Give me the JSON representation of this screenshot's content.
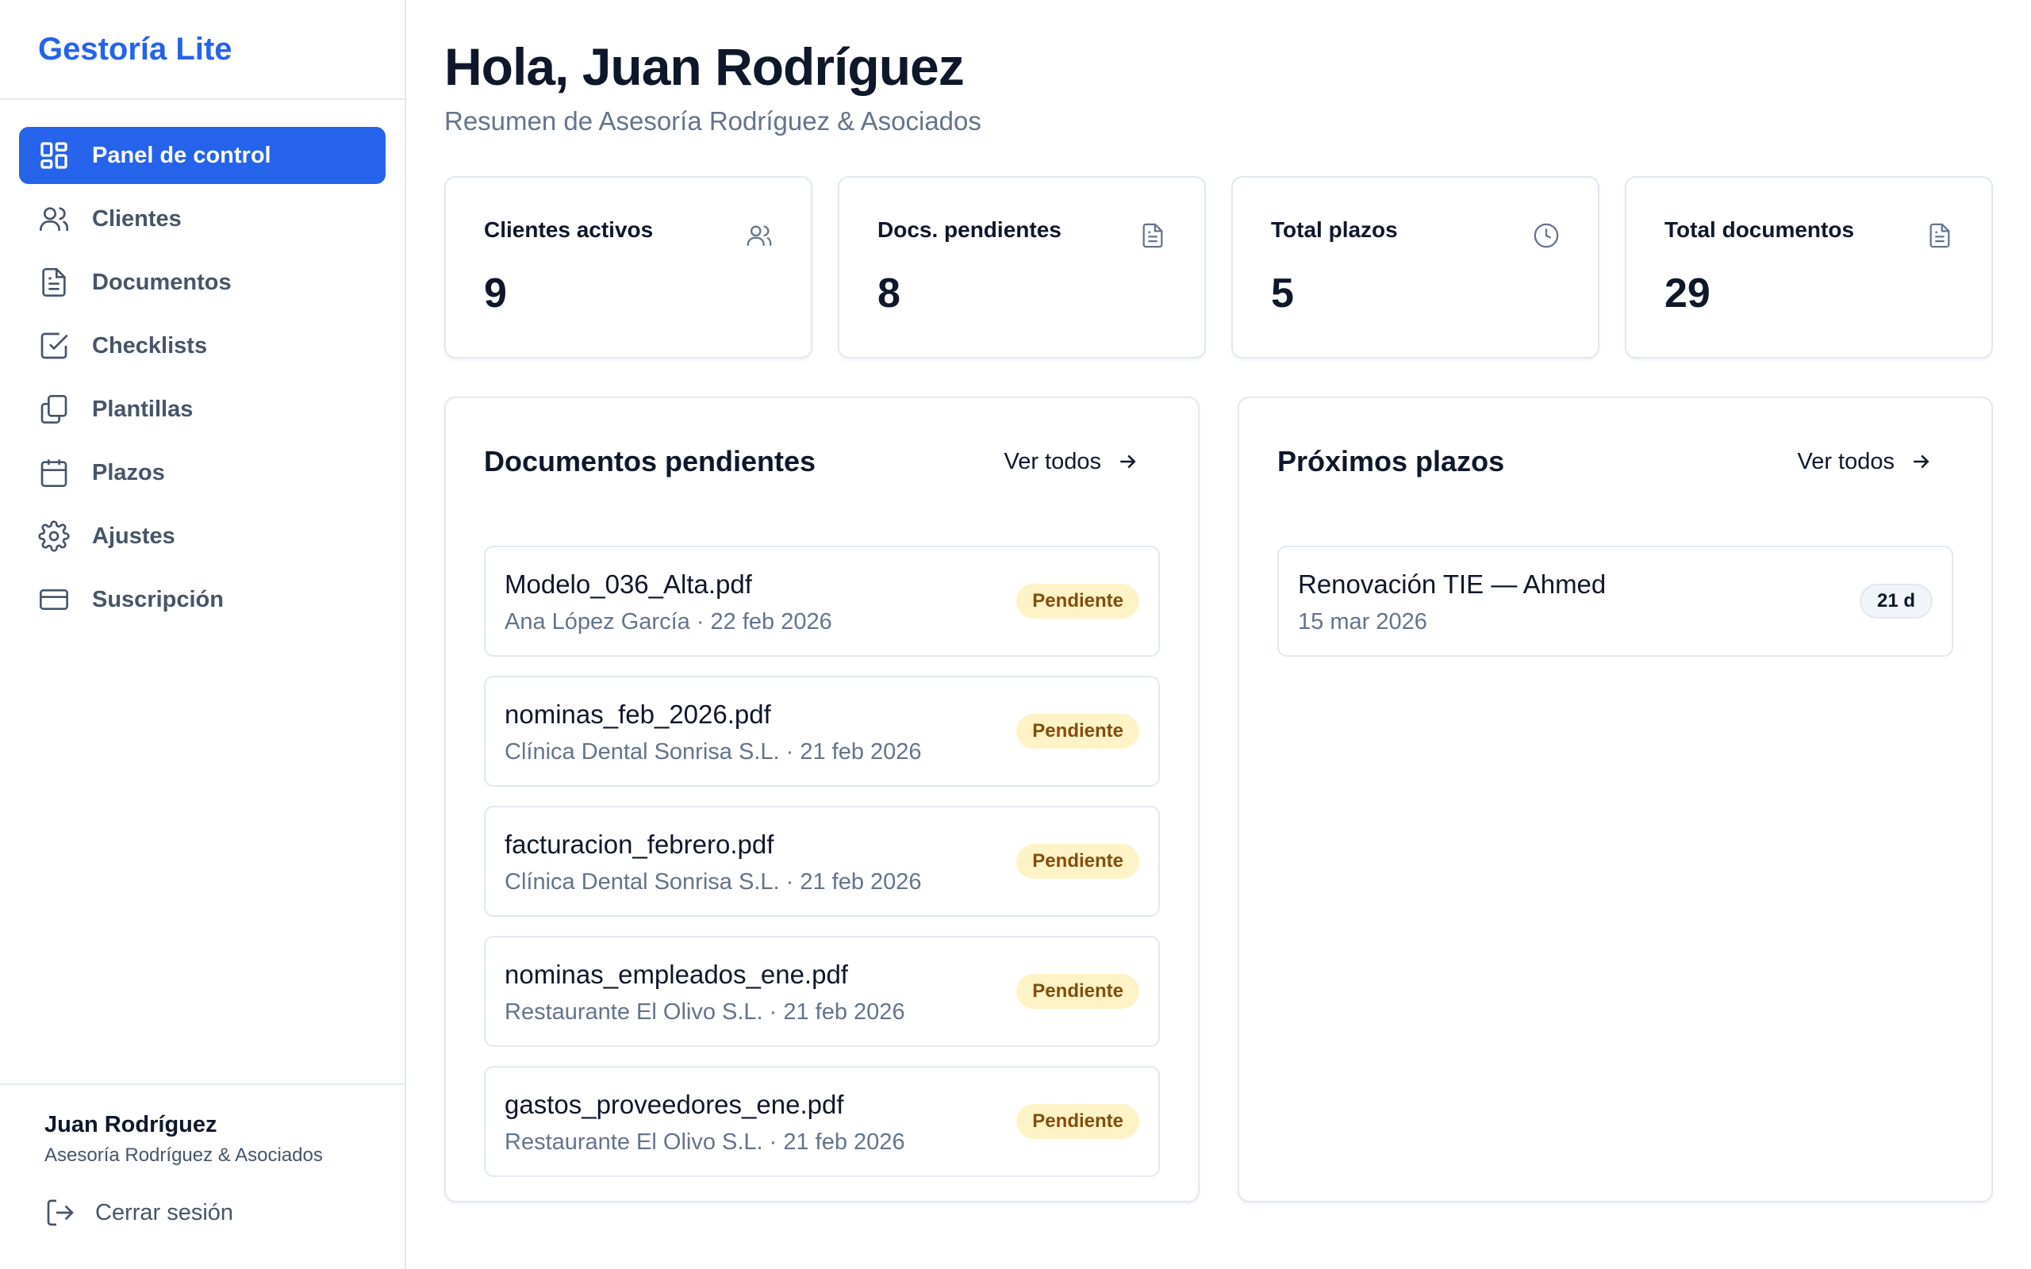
{
  "app": {
    "brand": "Gestoría Lite"
  },
  "sidebar": {
    "items": [
      {
        "label": "Panel de control",
        "icon": "layout-grid-icon",
        "active": true
      },
      {
        "label": "Clientes",
        "icon": "users-icon"
      },
      {
        "label": "Documentos",
        "icon": "document-icon"
      },
      {
        "label": "Checklists",
        "icon": "check-square-icon"
      },
      {
        "label": "Plantillas",
        "icon": "copy-icon"
      },
      {
        "label": "Plazos",
        "icon": "calendar-icon"
      },
      {
        "label": "Ajustes",
        "icon": "gear-icon"
      },
      {
        "label": "Suscripción",
        "icon": "credit-card-icon"
      }
    ],
    "user": {
      "name": "Juan Rodríguez",
      "org": "Asesoría Rodríguez & Asociados"
    },
    "logout_label": "Cerrar sesión"
  },
  "header": {
    "greeting": "Hola, Juan Rodríguez",
    "subtitle": "Resumen de Asesoría Rodríguez & Asociados"
  },
  "stats": [
    {
      "label": "Clientes activos",
      "value": "9",
      "icon": "users-icon"
    },
    {
      "label": "Docs. pendientes",
      "value": "8",
      "icon": "document-icon"
    },
    {
      "label": "Total plazos",
      "value": "5",
      "icon": "clock-icon"
    },
    {
      "label": "Total documentos",
      "value": "29",
      "icon": "document-icon"
    }
  ],
  "pending_docs": {
    "title": "Documentos pendientes",
    "view_all": "Ver todos",
    "items": [
      {
        "name": "Modelo_036_Alta.pdf",
        "meta": "Ana López García · 22 feb 2026",
        "status": "Pendiente"
      },
      {
        "name": "nominas_feb_2026.pdf",
        "meta": "Clínica Dental Sonrisa S.L. · 21 feb 2026",
        "status": "Pendiente"
      },
      {
        "name": "facturacion_febrero.pdf",
        "meta": "Clínica Dental Sonrisa S.L. · 21 feb 2026",
        "status": "Pendiente"
      },
      {
        "name": "nominas_empleados_ene.pdf",
        "meta": "Restaurante El Olivo S.L. · 21 feb 2026",
        "status": "Pendiente"
      },
      {
        "name": "gastos_proveedores_ene.pdf",
        "meta": "Restaurante El Olivo S.L. · 21 feb 2026",
        "status": "Pendiente"
      }
    ]
  },
  "deadlines": {
    "title": "Próximos plazos",
    "view_all": "Ver todos",
    "items": [
      {
        "name": "Renovación TIE — Ahmed",
        "date": "15 mar 2026",
        "days": "21 d"
      }
    ]
  },
  "colors": {
    "accent": "#2563eb",
    "badge_bg": "#fef3c7",
    "badge_text": "#854d0e"
  }
}
